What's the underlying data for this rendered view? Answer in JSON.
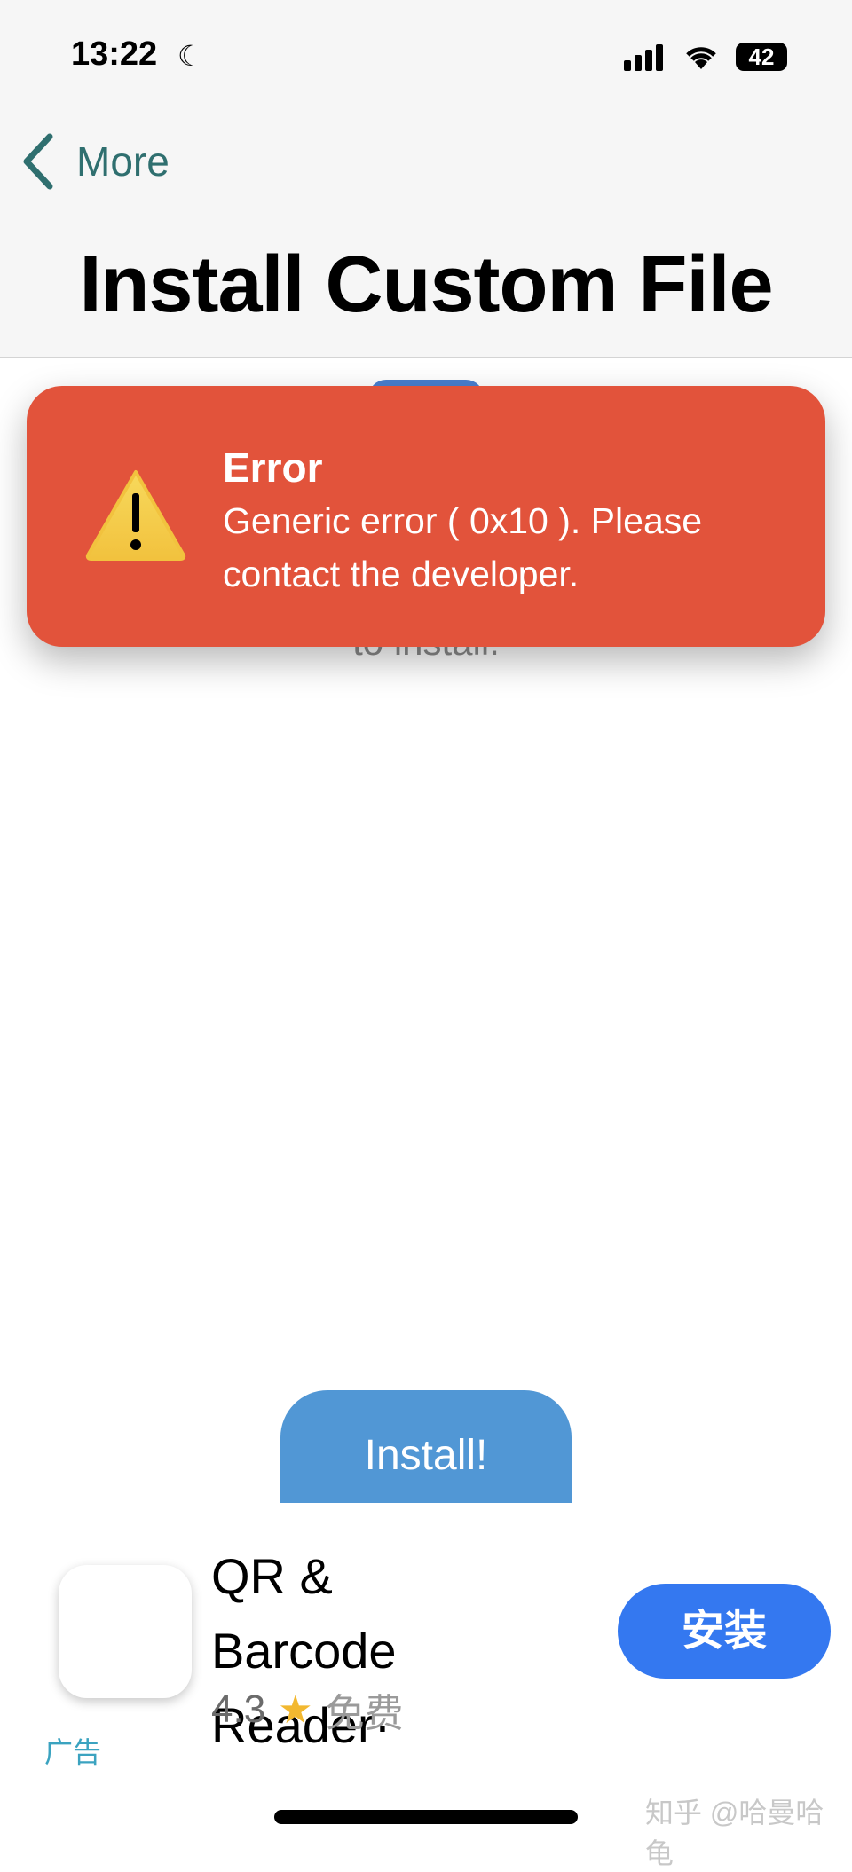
{
  "status_bar": {
    "time": "13:22",
    "battery": "42"
  },
  "nav": {
    "back_label": "More",
    "title": "Install Custom File"
  },
  "content": {
    "hint_text": "to install.",
    "install_button": "Install!"
  },
  "toast": {
    "title": "Error",
    "message": "Generic error ( 0x10 ). Please contact the developer.",
    "color": "#e2533b"
  },
  "ad": {
    "app_name": "QR & Barcode Reader·",
    "rating": "4.3",
    "price": "免费",
    "get_button": "安装",
    "ad_label": "广告"
  },
  "watermark": "知乎 @哈曼哈龟"
}
